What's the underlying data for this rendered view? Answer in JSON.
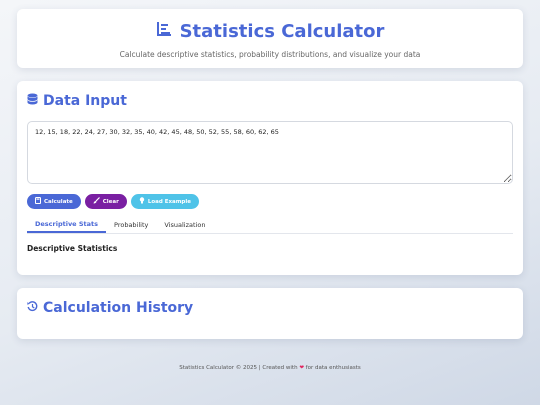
{
  "header": {
    "title": "Statistics Calculator",
    "subtitle": "Calculate descriptive statistics, probability distributions, and visualize your data"
  },
  "input": {
    "section_title": "Data Input",
    "data_value": "12, 15, 18, 22, 24, 27, 30, 32, 35, 40, 42, 45, 48, 50, 52, 55, 58, 60, 62, 65",
    "calculate_label": "Calculate",
    "clear_label": "Clear",
    "example_label": "Load Example"
  },
  "tabs": [
    {
      "label": "Descriptive Stats",
      "active": true
    },
    {
      "label": "Probability",
      "active": false
    },
    {
      "label": "Visualization",
      "active": false
    }
  ],
  "tab_content": {
    "title": "Descriptive Statistics"
  },
  "history": {
    "section_title": "Calculation History"
  },
  "footer": {
    "text_before": "Statistics Calculator © 2025 | Created with",
    "text_after": "for data enthusiasts"
  },
  "colors": {
    "accent": "#4a68d6",
    "clear_button": "#7a1fa2",
    "example_button": "#4fc3e8",
    "heart": "#e0245e"
  },
  "icons": {
    "title": "bar-chart-icon",
    "data_input": "database-icon",
    "calculate": "calculator-icon",
    "clear": "brush-icon",
    "example": "lightbulb-icon",
    "history": "history-icon",
    "footer": "heart-icon"
  }
}
